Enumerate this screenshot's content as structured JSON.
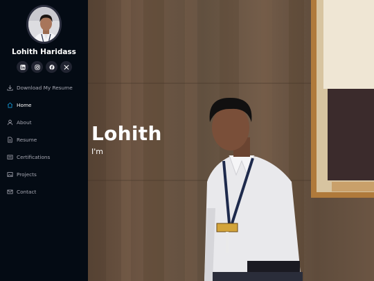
{
  "profile": {
    "name": "Lohith Haridass",
    "avatar_icon": "profile-photo"
  },
  "social": [
    {
      "name": "linkedin",
      "icon": "linkedin-icon"
    },
    {
      "name": "instagram",
      "icon": "instagram-icon"
    },
    {
      "name": "facebook",
      "icon": "facebook-icon"
    },
    {
      "name": "x",
      "icon": "x-icon"
    }
  ],
  "nav": {
    "items": [
      {
        "label": "Download My Resume",
        "icon": "download-icon",
        "active": false
      },
      {
        "label": "Home",
        "icon": "house-icon",
        "active": true
      },
      {
        "label": "About",
        "icon": "person-icon",
        "active": false
      },
      {
        "label": "Resume",
        "icon": "file-icon",
        "active": false
      },
      {
        "label": "Certifications",
        "icon": "certificate-icon",
        "active": false
      },
      {
        "label": "Projects",
        "icon": "image-icon",
        "active": false
      },
      {
        "label": "Contact",
        "icon": "envelope-icon",
        "active": false
      }
    ]
  },
  "hero": {
    "title": "Lohith",
    "subtitle": "I'm"
  },
  "colors": {
    "sidebar_bg": "#040b14",
    "nav_text": "#a8a9b4",
    "active_icon": "#149ddd",
    "social_btn_bg": "#212431"
  }
}
